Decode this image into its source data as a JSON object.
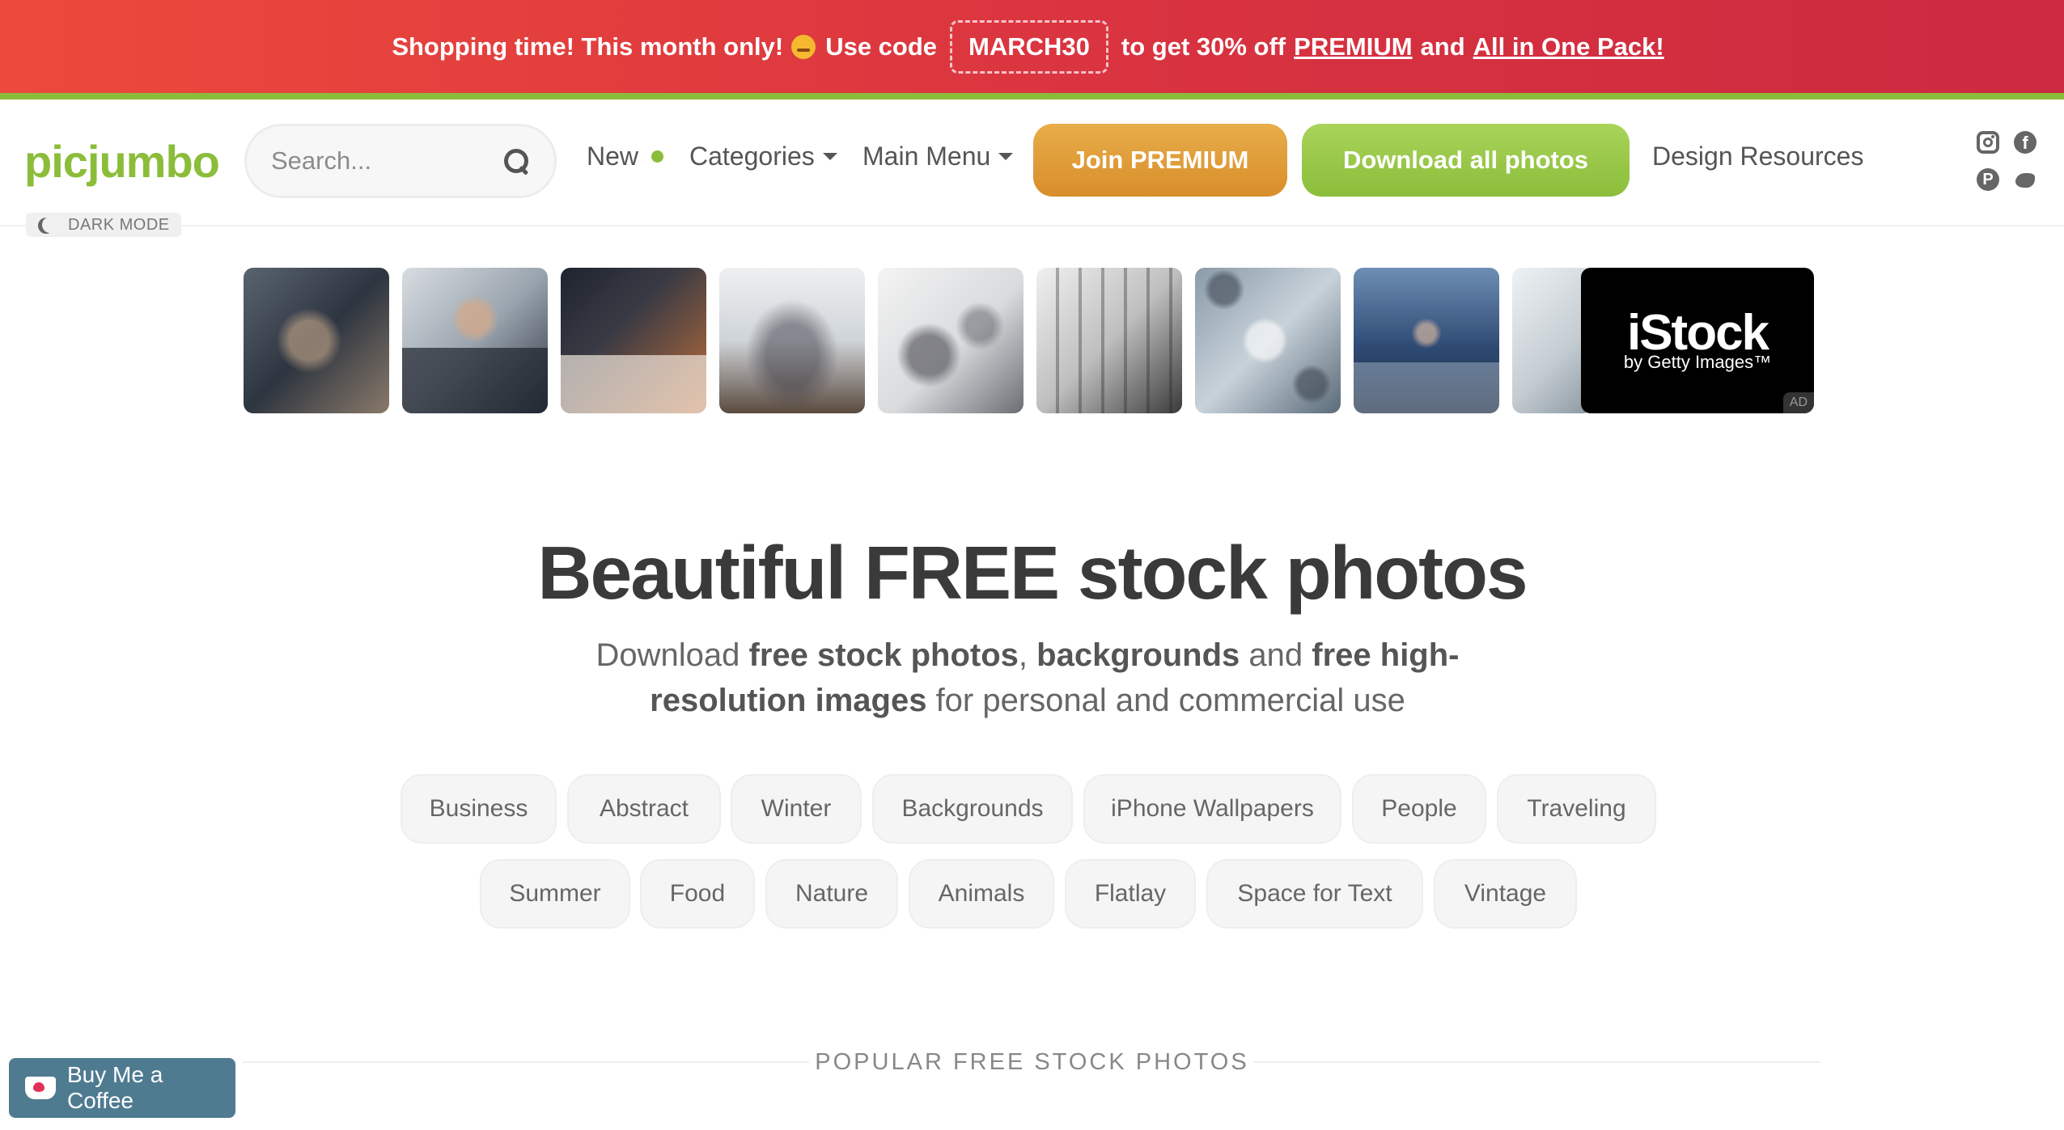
{
  "promo": {
    "text_before": "Shopping time! This month only!",
    "use_code": "Use code",
    "code": "MARCH30",
    "text_mid": "to get 30% off",
    "premium_link": "PREMIUM",
    "and": "and",
    "pack_link": "All in One Pack!"
  },
  "header": {
    "logo": "picjumbo",
    "search_placeholder": "Search...",
    "nav": {
      "new": "New",
      "categories": "Categories",
      "main_menu": "Main Menu",
      "design_resources": "Design Resources"
    },
    "join_premium": "Join PREMIUM",
    "download_all": "Download all photos",
    "dark_mode": "DARK MODE"
  },
  "ad": {
    "istock_logo": "iStock",
    "istock_sub": "by Getty Images™",
    "badge": "AD"
  },
  "hero": {
    "title": "Beautiful FREE stock photos",
    "sub": {
      "p1": "Download ",
      "b1": "free stock photos",
      "p2": ", ",
      "b2": "backgrounds",
      "p3": " and ",
      "b3": "free high-resolution images",
      "p4": " for personal and commercial use"
    }
  },
  "tags_row1": [
    "Business",
    "Abstract",
    "Winter",
    "Backgrounds",
    "iPhone Wallpapers",
    "People",
    "Traveling"
  ],
  "tags_row2": [
    "Summer",
    "Food",
    "Nature",
    "Animals",
    "Flatlay",
    "Space for Text",
    "Vintage"
  ],
  "section_title": "POPULAR FREE STOCK PHOTOS",
  "coffee_button": "Buy Me a Coffee",
  "colors": {
    "brand_green": "#8bbd3a",
    "premium_orange": "#e0a13c",
    "promo_red": "#d93340"
  }
}
